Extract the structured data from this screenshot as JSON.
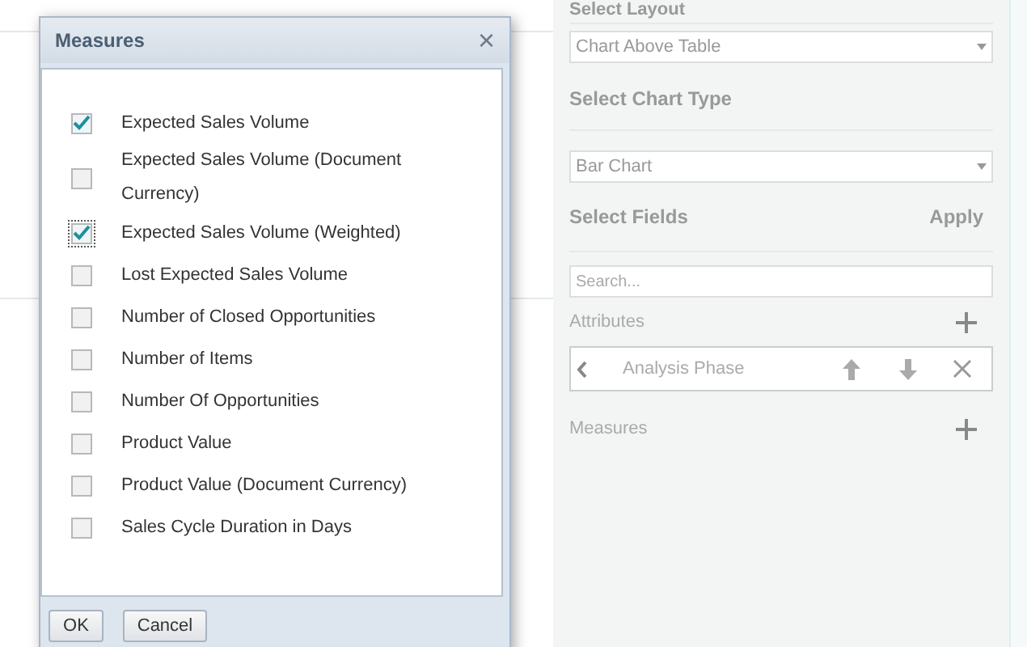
{
  "background_panel": {
    "select_layout_heading": "Select Layout",
    "layout_dropdown": {
      "value": "Chart Above Table"
    },
    "chart_type_heading": "Select Chart Type",
    "chart_type_dropdown": {
      "value": "Bar Chart"
    },
    "fields_heading": "Select Fields",
    "apply_button": "Apply",
    "search": {
      "placeholder": "Search..."
    },
    "attributes_label": "Attributes",
    "attributes": [
      {
        "label": "Analysis Phase"
      }
    ],
    "measures_label": "Measures"
  },
  "dialog": {
    "title": "Measures",
    "close": "×",
    "items": [
      {
        "label": "Expected Sales Volume",
        "checked": true,
        "focused": false
      },
      {
        "label": "Expected Sales Volume (Document Currency)",
        "checked": false,
        "focused": false
      },
      {
        "label": "Expected Sales Volume (Weighted)",
        "checked": true,
        "focused": true
      },
      {
        "label": "Lost Expected Sales Volume",
        "checked": false,
        "focused": false
      },
      {
        "label": "Number of Closed Opportunities",
        "checked": false,
        "focused": false
      },
      {
        "label": "Number of Items",
        "checked": false,
        "focused": false
      },
      {
        "label": "Number Of Opportunities",
        "checked": false,
        "focused": false
      },
      {
        "label": "Product Value",
        "checked": false,
        "focused": false
      },
      {
        "label": "Product Value (Document Currency)",
        "checked": false,
        "focused": false
      },
      {
        "label": "Sales Cycle Duration in Days",
        "checked": false,
        "focused": false
      }
    ],
    "buttons": [
      "OK",
      "Cancel"
    ]
  }
}
